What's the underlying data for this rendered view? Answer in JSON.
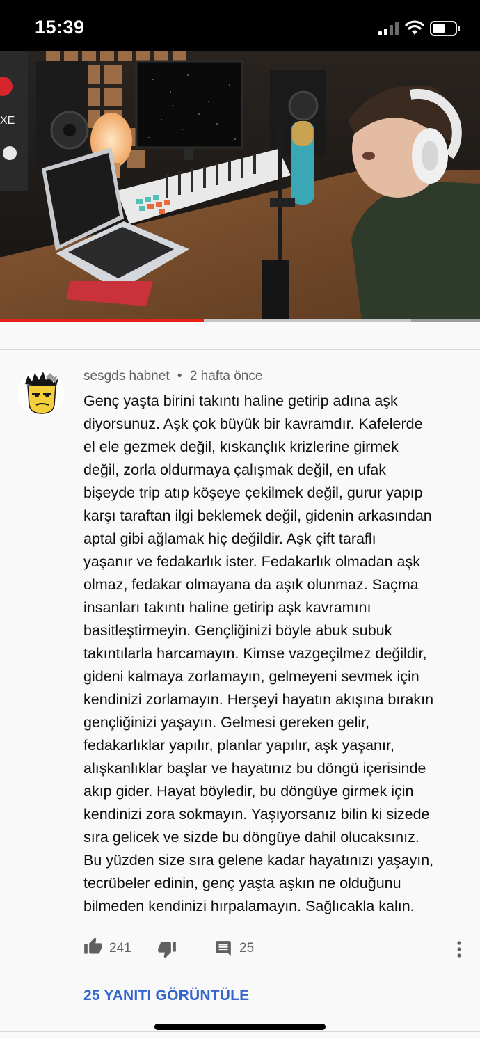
{
  "status_bar": {
    "time": "15:39",
    "battery_level": 0.55
  },
  "video": {
    "description_icon": "music-studio-thumbnail",
    "progress": 0.425,
    "buffered": 0.857,
    "colors": {
      "played": "#e62117",
      "buffered": "#c6c6c6",
      "track": "#9d9d9d"
    }
  },
  "comment": {
    "author": "sesgds habnet",
    "separator": "•",
    "time_ago": "2 hafta önce",
    "avatar_icon": "cartoon-avatar-icon",
    "lines": [
      "Genç yaşta birini takıntı haline getirip adına aşk",
      "diyorsunuz. Aşk çok büyük bir kavramdır. Kafelerde",
      "el ele gezmek değil, kıskançlık krizlerine girmek",
      "değil, zorla oldurmaya çalışmak değil, en ufak",
      "bişeyde trip atıp köşeye çekilmek değil, gurur yapıp",
      "karşı taraftan ilgi beklemek değil, gidenin arkasından",
      "aptal gibi ağlamak hiç değildir. Aşk çift taraflı",
      "yaşanır ve fedakarlık ister. Fedakarlık olmadan aşk",
      "olmaz, fedakar olmayana da aşık olunmaz. Saçma",
      "insanları takıntı haline getirip aşk kavramını",
      "basitleştirmeyin. Gençliğinizi böyle abuk subuk",
      "takıntılarla harcamayın. Kimse vazgeçilmez değildir,",
      "gideni kalmaya zorlamayın, gelmeyeni sevmek için",
      "kendinizi zorlamayın. Herşeyi hayatın akışına bırakın",
      "gençliğinizi yaşayın. Gelmesi gereken gelir,",
      "fedakarlıklar yapılır, planlar yapılır, aşk yaşanır,",
      "alışkanlıklar başlar ve hayatınız bu döngü içerisinde",
      "akıp gider. Hayat böyledir, bu döngüye girmek için",
      "kendinizi zora sokmayın. Yaşıyorsanız bilin ki sizede",
      "sıra gelicek ve sizde bu döngüye dahil olucaksınız.",
      "Bu yüzden size sıra gelene kadar hayatınızı yaşayın,",
      "tecrübeler edinin, genç yaşta aşkın ne olduğunu",
      "bilmeden kendinizi hırpalamayın. Sağlıcakla kalın."
    ],
    "like_count": "241",
    "reply_count": "25",
    "view_replies_label": "25 YANITI GÖRÜNTÜLE",
    "accent_color": "#3366cc"
  }
}
